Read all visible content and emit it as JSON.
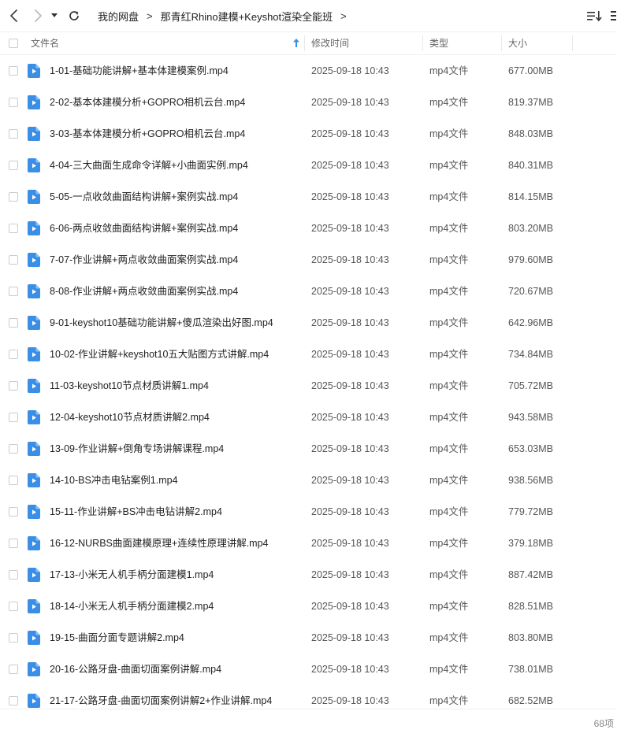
{
  "toolbar": {
    "breadcrumb": [
      "我的网盘",
      "那青红Rhino建模+Keyshot渲染全能班"
    ],
    "separator": ">"
  },
  "header": {
    "name": "文件名",
    "modified": "修改时间",
    "type": "类型",
    "size": "大小"
  },
  "colors": {
    "accent": "#3a8ee6",
    "sort_arrow": "#3a8ee6"
  },
  "files": [
    {
      "name": "1-01-基础功能讲解+基本体建模案例.mp4",
      "time": "2025-09-18 10:43",
      "type": "mp4文件",
      "size": "677.00MB"
    },
    {
      "name": "2-02-基本体建模分析+GOPRO相机云台.mp4",
      "time": "2025-09-18 10:43",
      "type": "mp4文件",
      "size": "819.37MB"
    },
    {
      "name": "3-03-基本体建模分析+GOPRO相机云台.mp4",
      "time": "2025-09-18 10:43",
      "type": "mp4文件",
      "size": "848.03MB"
    },
    {
      "name": "4-04-三大曲面生成命令详解+小曲面实例.mp4",
      "time": "2025-09-18 10:43",
      "type": "mp4文件",
      "size": "840.31MB"
    },
    {
      "name": "5-05-一点收敛曲面结构讲解+案例实战.mp4",
      "time": "2025-09-18 10:43",
      "type": "mp4文件",
      "size": "814.15MB"
    },
    {
      "name": "6-06-两点收敛曲面结构讲解+案例实战.mp4",
      "time": "2025-09-18 10:43",
      "type": "mp4文件",
      "size": "803.20MB"
    },
    {
      "name": "7-07-作业讲解+两点收敛曲面案例实战.mp4",
      "time": "2025-09-18 10:43",
      "type": "mp4文件",
      "size": "979.60MB"
    },
    {
      "name": "8-08-作业讲解+两点收敛曲面案例实战.mp4",
      "time": "2025-09-18 10:43",
      "type": "mp4文件",
      "size": "720.67MB"
    },
    {
      "name": "9-01-keyshot10基础功能讲解+傻瓜渲染出好图.mp4",
      "time": "2025-09-18 10:43",
      "type": "mp4文件",
      "size": "642.96MB"
    },
    {
      "name": "10-02-作业讲解+keyshot10五大贴图方式讲解.mp4",
      "time": "2025-09-18 10:43",
      "type": "mp4文件",
      "size": "734.84MB"
    },
    {
      "name": "11-03-keyshot10节点材质讲解1.mp4",
      "time": "2025-09-18 10:43",
      "type": "mp4文件",
      "size": "705.72MB"
    },
    {
      "name": "12-04-keyshot10节点材质讲解2.mp4",
      "time": "2025-09-18 10:43",
      "type": "mp4文件",
      "size": "943.58MB"
    },
    {
      "name": "13-09-作业讲解+倒角专场讲解课程.mp4",
      "time": "2025-09-18 10:43",
      "type": "mp4文件",
      "size": "653.03MB"
    },
    {
      "name": "14-10-BS冲击电钻案例1.mp4",
      "time": "2025-09-18 10:43",
      "type": "mp4文件",
      "size": "938.56MB"
    },
    {
      "name": "15-11-作业讲解+BS冲击电钻讲解2.mp4",
      "time": "2025-09-18 10:43",
      "type": "mp4文件",
      "size": "779.72MB"
    },
    {
      "name": "16-12-NURBS曲面建模原理+连续性原理讲解.mp4",
      "time": "2025-09-18 10:43",
      "type": "mp4文件",
      "size": "379.18MB"
    },
    {
      "name": "17-13-小米无人机手柄分面建模1.mp4",
      "time": "2025-09-18 10:43",
      "type": "mp4文件",
      "size": "887.42MB"
    },
    {
      "name": "18-14-小米无人机手柄分面建模2.mp4",
      "time": "2025-09-18 10:43",
      "type": "mp4文件",
      "size": "828.51MB"
    },
    {
      "name": "19-15-曲面分面专题讲解2.mp4",
      "time": "2025-09-18 10:43",
      "type": "mp4文件",
      "size": "803.80MB"
    },
    {
      "name": "20-16-公路牙盘-曲面切面案例讲解.mp4",
      "time": "2025-09-18 10:43",
      "type": "mp4文件",
      "size": "738.01MB"
    },
    {
      "name": "21-17-公路牙盘-曲面切面案例讲解2+作业讲解.mp4",
      "time": "2025-09-18 10:43",
      "type": "mp4文件",
      "size": "682.52MB"
    }
  ],
  "footer": {
    "count": "68项"
  }
}
